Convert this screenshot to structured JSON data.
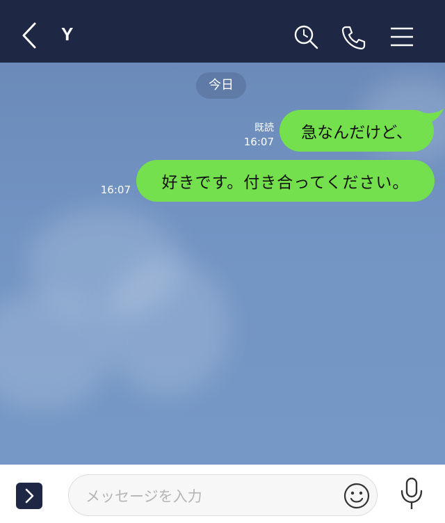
{
  "header": {
    "title": "Y",
    "icons": [
      "back-icon",
      "search-icon",
      "phone-icon",
      "menu-icon"
    ],
    "background": "#1e2844"
  },
  "chat": {
    "date_label": "今日",
    "messages": [
      {
        "text": "急なんだけど、",
        "read_label": "既読",
        "time": "16:07",
        "sender": "self"
      },
      {
        "text": "好きです。付き合ってください。",
        "time": "16:07",
        "sender": "self"
      }
    ],
    "bubble_color": "#74e04d",
    "background": "#7094c3"
  },
  "footer": {
    "input_placeholder": "メッセージを入力",
    "icons": [
      "expand-icon",
      "emoji-icon",
      "mic-icon"
    ]
  }
}
